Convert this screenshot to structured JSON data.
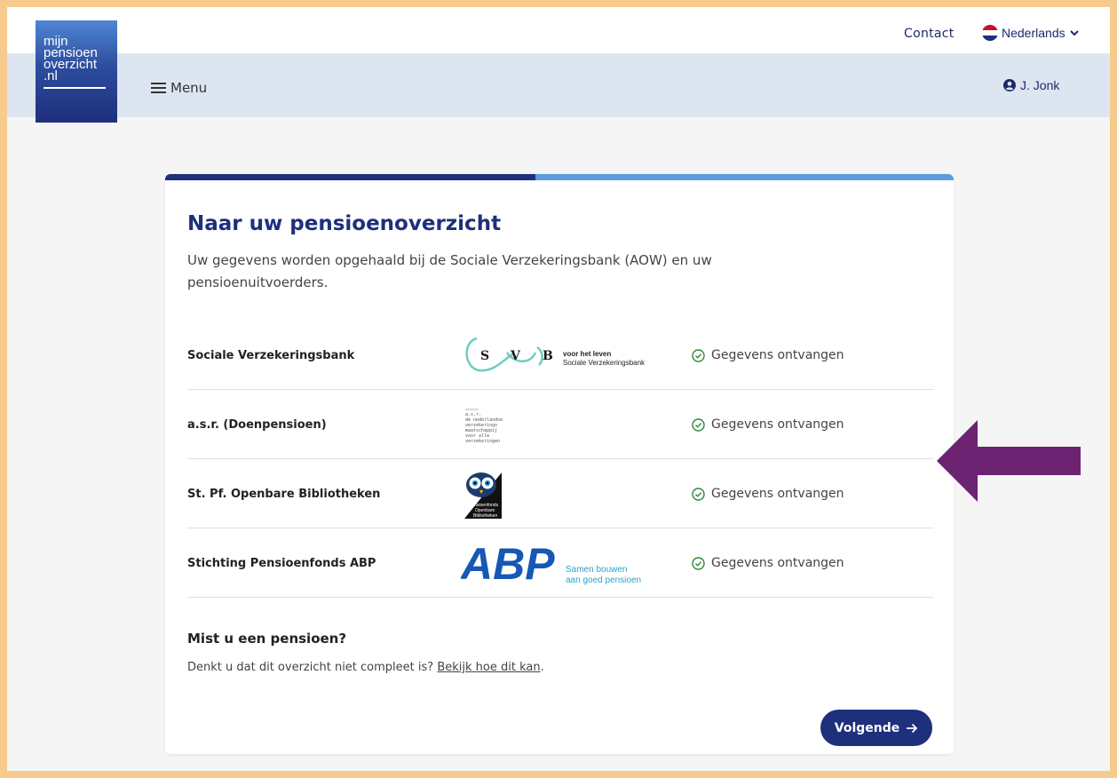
{
  "header": {
    "logo_lines": [
      "mijn",
      "pensioen",
      "overzicht",
      ".nl"
    ],
    "contact_label": "Contact",
    "language_label": "Nederlands",
    "menu_label": "Menu",
    "user_name": "J. Jonk"
  },
  "card": {
    "progress_fraction": 0.47,
    "title": "Naar uw pensioenoverzicht",
    "intro": "Uw gegevens worden opgehaald bij de Sociale Verzekeringsbank (AOW) en uw pensioenuitvoerders.",
    "providers": [
      {
        "name": "Sociale Verzekeringsbank",
        "logo_letters": [
          "S",
          "V",
          "B"
        ],
        "logo_tagline": "voor het leven",
        "logo_subtitle": "Sociale Verzekeringsbank",
        "status": "Gegevens ontvangen"
      },
      {
        "name": "a.s.r. (Doenpensioen)",
        "logo_text": [
          "a.s.r.",
          "de nederlandse",
          "verzekerings",
          "maatschappij",
          "voor alle",
          "verzekeringen"
        ],
        "status": "Gegevens ontvangen"
      },
      {
        "name": "St. Pf. Openbare Bibliotheken",
        "logo_text": [
          "Pensioenfonds",
          "Openbare",
          "Bibliotheken"
        ],
        "status": "Gegevens ontvangen"
      },
      {
        "name": "Stichting Pensioenfonds ABP",
        "logo_mark": "ABP",
        "logo_tagline": [
          "Samen bouwen",
          "aan goed pensioen"
        ],
        "status": "Gegevens ontvangen"
      }
    ],
    "missing_title": "Mist u een pensioen?",
    "missing_text": "Denkt u dat dit overzicht niet compleet is?",
    "missing_link": "Bekijk hoe dit kan",
    "missing_end": ".",
    "next_button": "Volgende"
  },
  "colors": {
    "border": "#f7cb8e",
    "brand_dark": "#1e2f7c",
    "progress_light": "#5b9ce0",
    "nav_bg": "#dde6f0",
    "annotation_arrow": "#6b2372"
  },
  "icons": {
    "language": "netherlands-flag-icon",
    "menu": "hamburger-icon",
    "user": "user-circle-icon",
    "status": "check-circle-icon",
    "next": "arrow-right-icon"
  }
}
